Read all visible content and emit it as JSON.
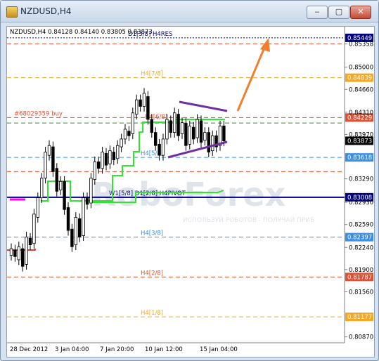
{
  "window": {
    "title": "NZDUSD,H4",
    "minimize_label": "‒",
    "maximize_label": "▢",
    "close_label": "✕"
  },
  "chart_header": {
    "text": "NZDUSD,H4  0.84128 0.84140 0.83805 0.83873"
  },
  "watermark": {
    "logo_text": "RoboForex",
    "tagline": "ИСПОЛЬЗУЙ РОБОТОВ - ПОЛУЧАЙ ПРИБ"
  },
  "chart_data": {
    "type": "candlestick",
    "symbol": "NZDUSD",
    "timeframe": "H4",
    "ohlc_header": {
      "open": 0.84128,
      "high": 0.8414,
      "low": 0.83805,
      "close": 0.83873
    },
    "ylim": [
      0.8078,
      0.8562
    ],
    "y_ticks": [
      "0.85358",
      "0.85000",
      "0.84660",
      "0.84310",
      "0.83970",
      "0.83290",
      "0.82930",
      "0.82590",
      "0.82240",
      "0.81900",
      "0.81560",
      "0.80870"
    ],
    "x_ticks": [
      "28 Dec 2012",
      "3 Jan 04:00",
      "7 Jan 20:00",
      "10 Jan 12:00",
      "15 Jan 04:00"
    ],
    "levels": [
      {
        "label": "D1[3/8] H4RES",
        "price": 0.85449,
        "price_label": "0.85449",
        "color": "#000080",
        "style": "dotted"
      },
      {
        "label": "",
        "price": 0.85358,
        "price_label": "",
        "color": "#e05030",
        "style": "dashed"
      },
      {
        "label": "H4[7/8]",
        "price": 0.84839,
        "price_label": "0.84839",
        "color": "#f5a623",
        "style": "dashed"
      },
      {
        "label": "#68029359 buy",
        "price": 0.84229,
        "price_label": "0.84229",
        "color": "#e05030",
        "style": "dashed"
      },
      {
        "label": "",
        "price": 0.84145,
        "price_label": "",
        "color": "#2a8a2a",
        "style": "dashed"
      },
      {
        "label": "H4[5/8]",
        "price": 0.83618,
        "price_label": "0.83618",
        "color": "#3a8ee6",
        "style": "dashed"
      },
      {
        "label": "",
        "price": 0.834,
        "price_label": "",
        "color": "#e05030",
        "style": "dashed"
      },
      {
        "label": "W1[5/8] D1[2/8] H4PIVOT",
        "price": 0.83008,
        "price_label": "0.83008",
        "color": "#000080",
        "style": "solid"
      },
      {
        "label": "H4[3/8]",
        "price": 0.82397,
        "price_label": "0.82397",
        "color": "#3a8ee6",
        "style": "dashed"
      },
      {
        "label": "H4[2/8]",
        "price": 0.81787,
        "price_label": "0.81787",
        "color": "#e05030",
        "style": "dashed"
      },
      {
        "label": "H4[1/8]",
        "price": 0.81177,
        "price_label": "0.81177",
        "color": "#f5a623",
        "style": "dashed"
      }
    ],
    "h4_label_marker": "H4[6/8]",
    "current_price_label": "0.83873",
    "current_price": 0.83873,
    "forecast_arrow": "up",
    "colors": {
      "bull_candle": "#000000",
      "bear_candle": "#000000",
      "trend_line": "#7030a0",
      "stop_line": "#2ee62e",
      "arrow": "#f08030"
    }
  }
}
